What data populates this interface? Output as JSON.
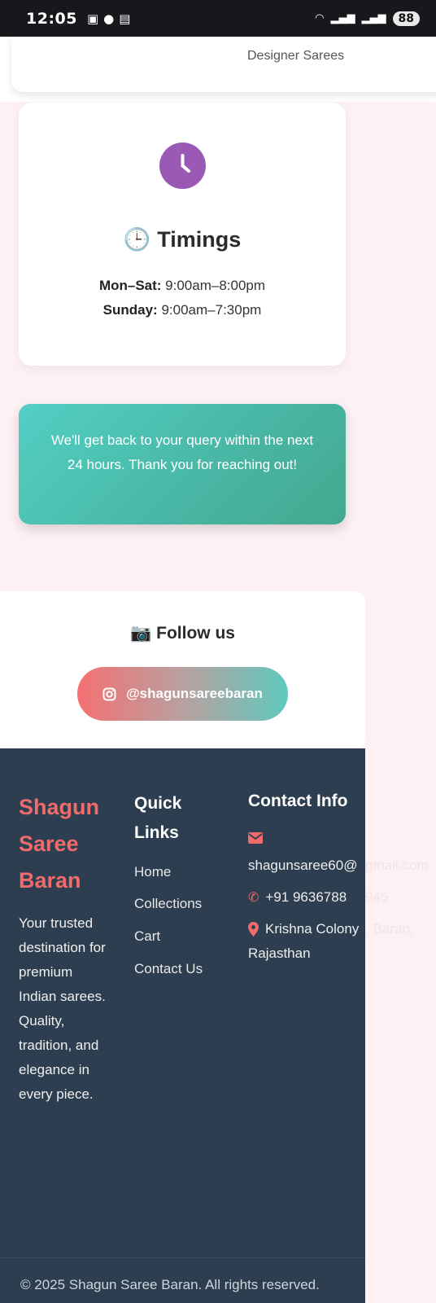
{
  "status_bar": {
    "time": "12:05",
    "battery": "88"
  },
  "top_card": {
    "text": "Designer Sarees"
  },
  "timings": {
    "title_emoji": "🕒",
    "title": "Timings",
    "weekday_label": "Mon–Sat:",
    "weekday_hours": "9:00am–8:00pm",
    "sunday_label": "Sunday:",
    "sunday_hours": "9:00am–7:30pm"
  },
  "notice": {
    "text": "We'll get back to your query within the next 24 hours. Thank you for reaching out!"
  },
  "follow": {
    "title_emoji": "📷",
    "title": "Follow us",
    "handle": "@shagunsareebaran"
  },
  "footer": {
    "brand": "Shagun Saree Baran",
    "tagline": "Your trusted destination for premium Indian sarees. Quality, tradition, and elegance in every piece.",
    "quick_links_title": "Quick Links",
    "quick_links": [
      "Home",
      "Collections",
      "Cart",
      "Contact Us"
    ],
    "contact_title": "Contact Info",
    "email_visible": "shagunsaree60@",
    "email_overflow": "gmail.com",
    "phone_visible": "+91 9636788",
    "phone_overflow": "945",
    "address_line1_visible": "Krishna Colony",
    "address_line1_overflow": ", Baran,",
    "address_line2": "Rajasthan",
    "copyright": "© 2025 Shagun Saree Baran. All rights reserved."
  },
  "colors": {
    "footer_bg": "#2c3e50",
    "brand_accent": "#f06b6b",
    "clock_purple": "#9b59b6",
    "teal": "#4cbfae"
  }
}
